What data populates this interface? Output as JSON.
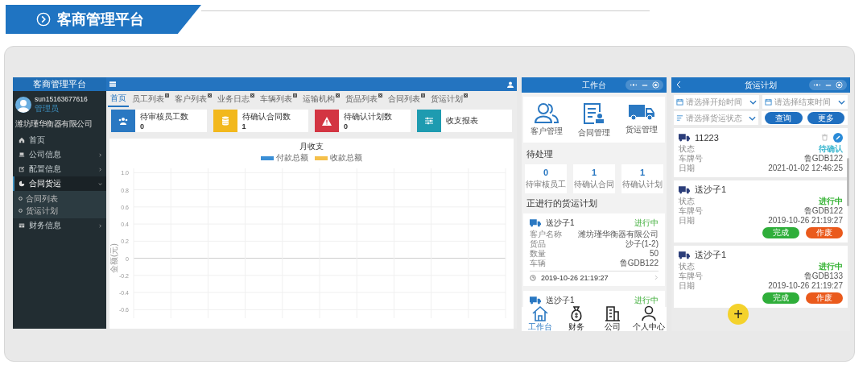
{
  "banner": {
    "title": "客商管理平台"
  },
  "admin": {
    "title": "客商管理平台",
    "user": {
      "name": "sun15163677616",
      "role": "管理员",
      "company": "潍坊瑾华衡器有限公司"
    },
    "sidebar": {
      "items": [
        {
          "label": "首页",
          "expandable": false,
          "expanded": false,
          "selected": false
        },
        {
          "label": "公司信息",
          "expandable": true,
          "expanded": false,
          "selected": false
        },
        {
          "label": "配置信息",
          "expandable": true,
          "expanded": false,
          "selected": false
        },
        {
          "label": "合同货运",
          "expandable": true,
          "expanded": true,
          "selected": true,
          "children": [
            {
              "label": "合同列表"
            },
            {
              "label": "货运计划"
            }
          ]
        },
        {
          "label": "财务信息",
          "expandable": true,
          "expanded": false,
          "selected": false
        }
      ]
    },
    "tabs": [
      {
        "label": "首页",
        "selected": true,
        "closable": false
      },
      {
        "label": "员工列表",
        "selected": false,
        "closable": true
      },
      {
        "label": "客户列表",
        "selected": false,
        "closable": true
      },
      {
        "label": "业务日志",
        "selected": false,
        "closable": true
      },
      {
        "label": "车辆列表",
        "selected": false,
        "closable": true
      },
      {
        "label": "运输机构",
        "selected": false,
        "closable": true
      },
      {
        "label": "货品列表",
        "selected": false,
        "closable": true
      },
      {
        "label": "合同列表",
        "selected": false,
        "closable": true
      },
      {
        "label": "货运计划",
        "selected": false,
        "closable": true
      }
    ],
    "stats": [
      {
        "label": "待审核员工数",
        "value": "0",
        "color": "#2a78c2"
      },
      {
        "label": "待确认合同数",
        "value": "1",
        "color": "#f2b81c"
      },
      {
        "label": "待确认计划数",
        "value": "0",
        "color": "#d33542"
      },
      {
        "label": "收支报表",
        "color": "#1e9bb0"
      }
    ],
    "chart_data": {
      "type": "line",
      "grid": true,
      "title": "月收支",
      "ylabel": "金额(元)",
      "ylim": [
        -0.7,
        1.05
      ],
      "yticks": [
        {
          "value": 1.0,
          "label": "1.0"
        },
        {
          "value": 0.8,
          "label": "0.8"
        },
        {
          "value": 0.6,
          "label": "0.6"
        },
        {
          "value": 0.4,
          "label": "0.4"
        },
        {
          "value": 0.2,
          "label": "0.2"
        },
        {
          "value": 0,
          "label": "0"
        },
        {
          "value": -0.2,
          "label": "-0.2"
        },
        {
          "value": -0.4,
          "label": "-0.4"
        },
        {
          "value": -0.6,
          "label": "-0.6"
        }
      ],
      "series": [
        {
          "name": "付款总额",
          "color": "#3a8fd6"
        },
        {
          "name": "收款总额",
          "color": "#f5c04a"
        }
      ]
    }
  },
  "workbench": {
    "title": "工作台",
    "shortcuts": [
      {
        "label": "客户管理"
      },
      {
        "label": "合同管理"
      },
      {
        "label": "货运管理"
      }
    ],
    "pending_title": "待处理",
    "pending": [
      {
        "value": "0",
        "label": "待审核员工"
      },
      {
        "value": "1",
        "label": "待确认合同"
      },
      {
        "value": "1",
        "label": "待确认计划"
      }
    ],
    "plans_title": "正进行的货运计划",
    "plans": [
      {
        "name": "送沙子1",
        "status": "进行中",
        "fields": [
          {
            "label": "客户名称",
            "value": "潍坊瑾华衡器有限公司"
          },
          {
            "label": "货品",
            "value": "沙子(1-2)"
          },
          {
            "label": "数量",
            "value": "50"
          },
          {
            "label": "车辆",
            "value": "鲁GDB122"
          }
        ],
        "time": "2019-10-26 21:19:27"
      },
      {
        "name": "送沙子1",
        "status": "进行中"
      }
    ],
    "nav": [
      {
        "label": "工作台",
        "selected": true
      },
      {
        "label": "财务",
        "selected": false
      },
      {
        "label": "公司",
        "selected": false
      },
      {
        "label": "个人中心",
        "selected": false
      }
    ]
  },
  "plan_list": {
    "title": "货运计划",
    "filters": [
      {
        "placeholder": "请选择开始时间"
      },
      {
        "placeholder": "请选择结束时间"
      },
      {
        "placeholder": "请选择货运状态"
      }
    ],
    "buttons": [
      "查询",
      "更多"
    ],
    "plans": [
      {
        "kind": "pending",
        "name": "11223",
        "status": "待确认",
        "color": "#3db7cf",
        "fields": [
          {
            "label": "状态"
          },
          {
            "label": "车牌号",
            "value": "鲁GDB122"
          },
          {
            "label": "日期",
            "value": "2021-01-02 12:46:25"
          }
        ]
      },
      {
        "kind": "active",
        "name": "送沙子1",
        "status": "进行中",
        "color": "#34b233",
        "fields": [
          {
            "label": "状态"
          },
          {
            "label": "车牌号",
            "value": "鲁GDB122"
          },
          {
            "label": "日期",
            "value": "2019-10-26 21:19:27"
          }
        ],
        "actions": [
          "完成",
          "作废"
        ]
      },
      {
        "kind": "active",
        "name": "送沙子1",
        "status": "进行中",
        "color": "#34b233",
        "fields": [
          {
            "label": "状态"
          },
          {
            "label": "车牌号",
            "value": "鲁GDB133"
          },
          {
            "label": "日期",
            "value": "2019-10-26 21:19:27"
          }
        ],
        "actions": [
          "完成",
          "作废"
        ]
      }
    ],
    "fab": "+"
  }
}
